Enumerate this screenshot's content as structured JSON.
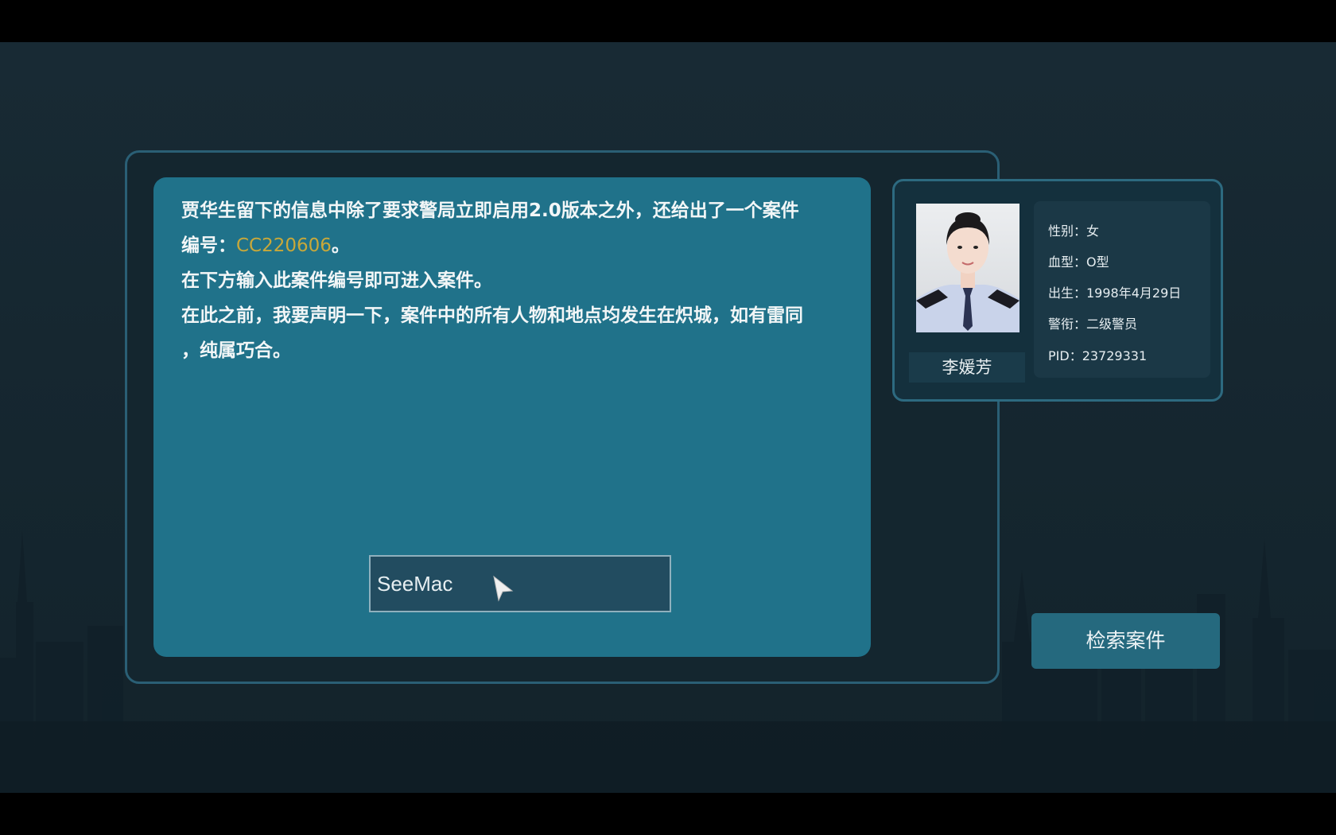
{
  "message": {
    "line1": "贾华生留下的信息中除了要求警局立即启用2.0版本之外，还给出了一个案件",
    "line2_prefix": "编号：",
    "case_code": "CC220606",
    "line2_suffix": "。",
    "line3": "在下方输入此案件编号即可进入案件。",
    "line4": "在此之前，我要声明一下，案件中的所有人物和地点均发生在炽城，如有雷同",
    "line5": "，纯属巧合。"
  },
  "case_input": {
    "value": "SeeMac"
  },
  "profile": {
    "name": "李媛芳",
    "gender": "性别：女",
    "blood_type": "血型：O型",
    "birth": "出生：1998年4月29日",
    "rank": "警衔：二级警员",
    "pid": "PID：23729331"
  },
  "search_button": {
    "label": "检索案件"
  },
  "colors": {
    "accent_code": "#c8a83a",
    "panel": "#20728a",
    "frame_border": "#2a5f75",
    "button": "#25697e"
  }
}
